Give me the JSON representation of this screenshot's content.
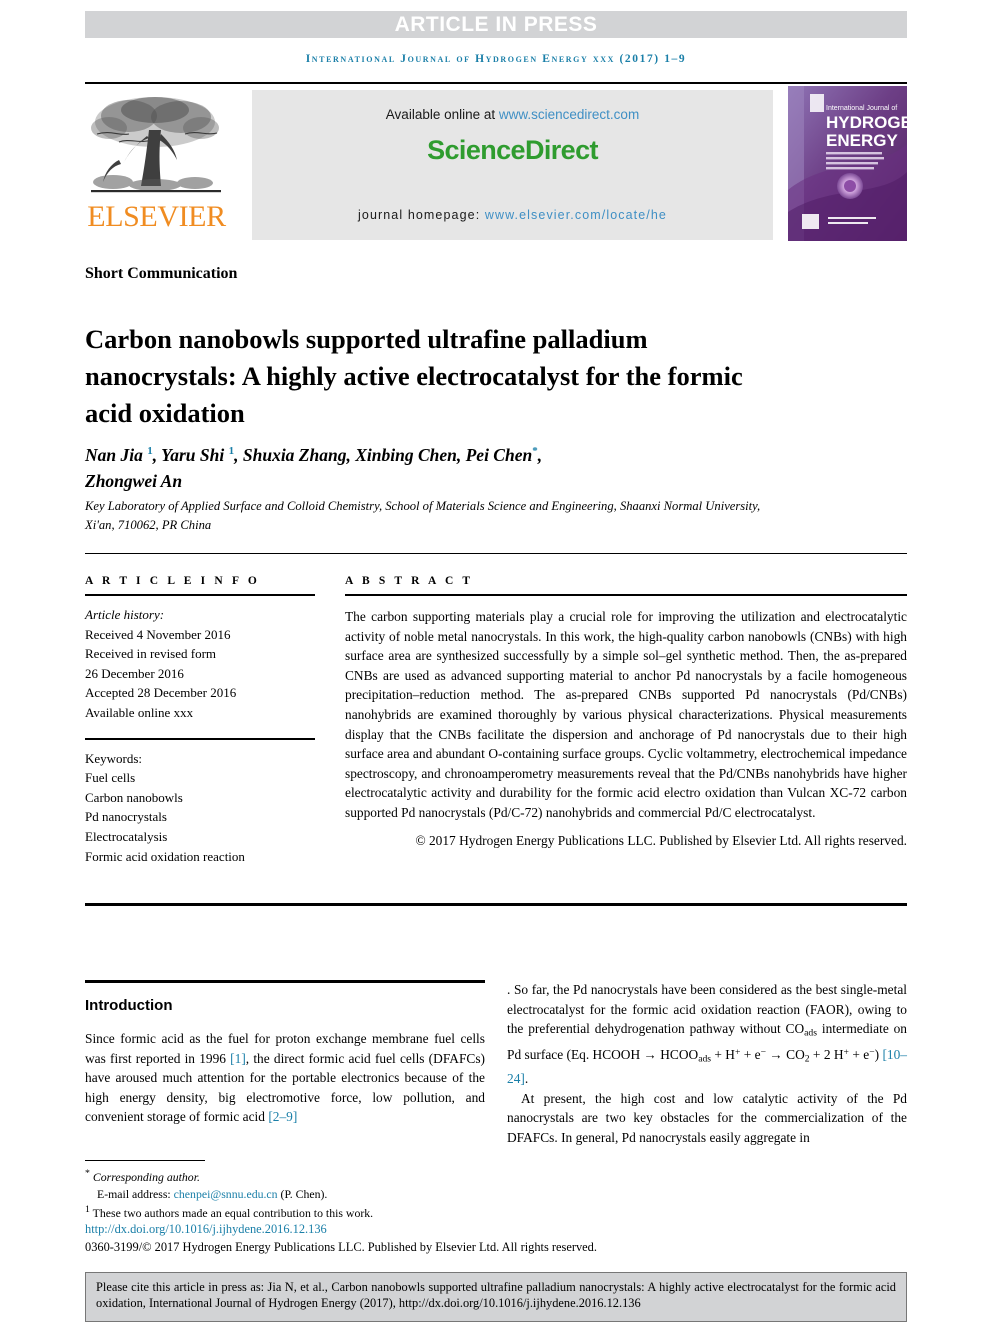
{
  "banner": {
    "text": "ARTICLE IN PRESS"
  },
  "running_head": {
    "text": "International Journal of Hydrogen Energy xxx (2017) 1–9"
  },
  "masthead": {
    "publisher_name": "ELSEVIER",
    "publisher_logo_icon": "elsevier-tree-icon",
    "available_online_prefix": "Available online at ",
    "available_online_link": "www.sciencedirect.com",
    "sciencedirect_wordmark": "ScienceDirect",
    "journal_homepage_prefix": "journal homepage: ",
    "journal_homepage_link": "www.elsevier.com/locate/he",
    "cover_line1": "International Journal of",
    "cover_line2": "HYDROGEN",
    "cover_line3": "ENERGY"
  },
  "article": {
    "type": "Short Communication",
    "title": "Carbon nanobowls supported ultrafine palladium nanocrystals: A highly active electrocatalyst for the formic acid oxidation",
    "authors_line1_a": "Nan Jia ",
    "authors_mark1": "1",
    "authors_line1_b": ", Yaru Shi ",
    "authors_mark2": "1",
    "authors_line1_c": ", Shuxia Zhang, Xinbing Chen, Pei Chen",
    "authors_mark3": "*",
    "authors_line1_d": ",",
    "authors_line2": "Zhongwei An",
    "affiliation": "Key Laboratory of Applied Surface and Colloid Chemistry, School of Materials Science and Engineering, Shaanxi Normal University, Xi'an, 710062, PR China"
  },
  "info": {
    "heading": "A R T I C L E  I N F O",
    "history_label": "Article history:",
    "history": [
      "Received 4 November 2016",
      "Received in revised form",
      "26 December 2016",
      "Accepted 28 December 2016",
      "Available online xxx"
    ],
    "keywords_label": "Keywords:",
    "keywords": [
      "Fuel cells",
      "Carbon nanobowls",
      "Pd nanocrystals",
      "Electrocatalysis",
      "Formic acid oxidation reaction"
    ]
  },
  "abstract": {
    "heading": "A B S T R A C T",
    "text": "The carbon supporting materials play a crucial role for improving the utilization and electrocatalytic activity of noble metal nanocrystals. In this work, the high-quality carbon nanobowls (CNBs) with high surface area are synthesized successfully by a simple sol–gel synthetic method. Then, the as-prepared CNBs are used as advanced supporting material to anchor Pd nanocrystals by a facile homogeneous precipitation–reduction method. The as-prepared CNBs supported Pd nanocrystals (Pd/CNBs) nanohybrids are examined thoroughly by various physical characterizations. Physical measurements display that the CNBs facilitate the dispersion and anchorage of Pd nanocrystals due to their high surface area and abundant O-containing surface groups. Cyclic voltammetry, electrochemical impedance spectroscopy, and chronoamperometry measurements reveal that the Pd/CNBs nanohybrids have higher electrocatalytic activity and durability for the formic acid electro oxidation than Vulcan XC-72 carbon supported Pd nanocrystals (Pd/C-72) nanohybrids and commercial Pd/C electrocatalyst.",
    "copyright": "© 2017 Hydrogen Energy Publications LLC. Published by Elsevier Ltd. All rights reserved."
  },
  "introduction": {
    "heading": "Introduction",
    "para1_part1": "Since formic acid as the fuel for proton exchange membrane fuel cells was first reported in 1996 ",
    "para1_ref1": "[1]",
    "para1_part2": ", the direct formic acid fuel cells (DFAFCs) have aroused much attention for the portable electronics because of the high energy density, big electromotive force, low pollution, and convenient storage of formic acid ",
    "para1_ref2": "[2–9]",
    "para1_part3": ". So far, the Pd nanocrystals have been considered as the best single-metal electrocatalyst for the formic acid oxidation reaction (FAOR), owing to the preferential dehydrogenation pathway without CO",
    "para1_sub1": "ads",
    "para1_part4": " intermediate on Pd surface (Eq. HCOOH → HCOO",
    "para1_sub2": "ads",
    "para1_part5": " + H",
    "para1_sup1": "+",
    "para1_part6": " + e",
    "para1_sup2": "−",
    "para1_part7": " → CO",
    "para1_sub3": "2",
    "para1_part8": " + 2 H",
    "para1_sup3": "+",
    "para1_part9": " + e",
    "para1_sup4": "−",
    "para1_part10": ") ",
    "para1_ref3": "[10–24]",
    "para1_part11": ".",
    "para2": "At present, the high cost and low catalytic activity of the Pd nanocrystals are two key obstacles for the commercialization of the DFAFCs. In general, Pd nanocrystals easily aggregate in"
  },
  "footnotes": {
    "corresponding_mark": "*",
    "corresponding_label": "Corresponding author.",
    "email_label": "E-mail address: ",
    "email_value": "chenpei@snnu.edu.cn",
    "email_suffix": " (P. Chen).",
    "equal_mark": "1",
    "equal_text": "These two authors made an equal contribution to this work.",
    "doi": "http://dx.doi.org/10.1016/j.ijhydene.2016.12.136",
    "issn": "0360-3199/© 2017 Hydrogen Energy Publications LLC. Published by Elsevier Ltd. All rights reserved."
  },
  "cite_box": {
    "text": "Please cite this article in press as: Jia N, et al., Carbon nanobowls supported ultrafine palladium nanocrystals: A highly active electrocatalyst for the formic acid oxidation, International Journal of Hydrogen Energy (2017), http://dx.doi.org/10.1016/j.ijhydene.2016.12.136"
  },
  "colors": {
    "banner_gray": "#d2d3d5",
    "link_blue": "#1a7fa8",
    "sciencedirect_green": "#2f9c2f",
    "elsevier_orange": "#f08c21",
    "sd_box_gray": "#e6e6e6"
  }
}
